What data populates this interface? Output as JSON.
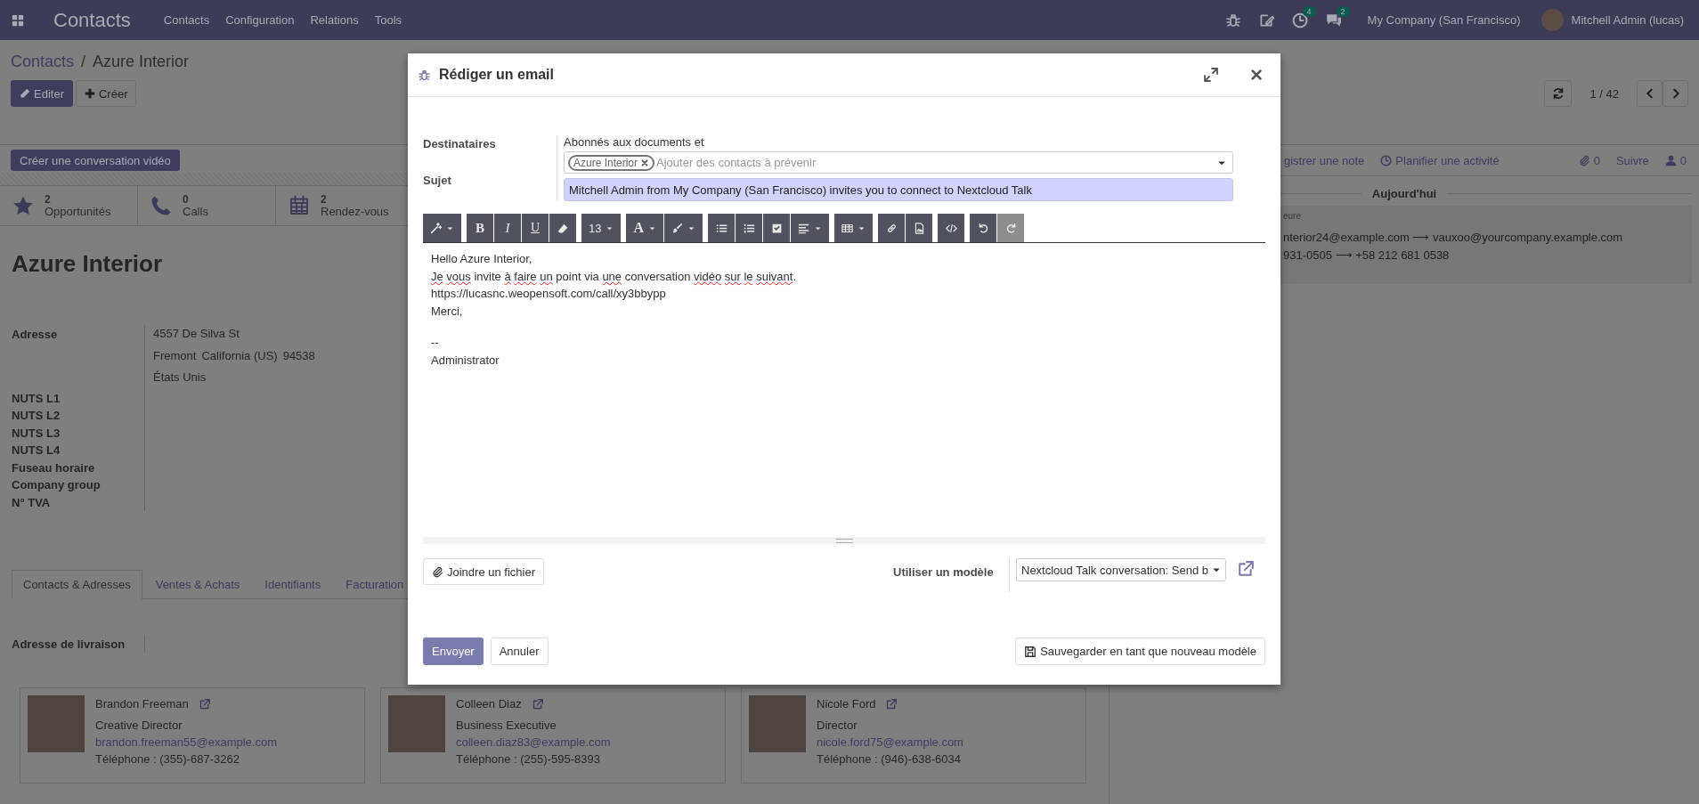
{
  "navbar": {
    "app_name": "Contacts",
    "menus": [
      "Contacts",
      "Configuration",
      "Relations",
      "Tools"
    ],
    "activity_count": "4",
    "message_count": "2",
    "company": "My Company (San Francisco)",
    "user": "Mitchell Admin (lucas)"
  },
  "breadcrumb": {
    "items": [
      "Contacts",
      "Azure Interior"
    ],
    "separator": "/"
  },
  "actions": [
    {
      "label": "Editer",
      "kind": "edit"
    },
    {
      "label": "Créer",
      "kind": "create"
    }
  ],
  "pager": "1 / 42",
  "status_button": "Créer une conversation vidéo",
  "stats": [
    {
      "count": "2",
      "label": "Opportunités",
      "kind": "opportunities"
    },
    {
      "count": "0",
      "label": "Calls",
      "kind": "calls"
    },
    {
      "count": "2",
      "label": "Rendez-vous",
      "kind": "meetings"
    }
  ],
  "partner": {
    "name": "Azure Interior",
    "address_label": "Adresse",
    "address_lines": [
      [
        "4557 De Silva St"
      ],
      [
        "Fremont",
        "California (US)",
        "94538"
      ],
      [
        "États Unis"
      ]
    ],
    "field_labels": [
      "NUTS L1",
      "NUTS L2",
      "NUTS L3",
      "NUTS L4",
      "Fuseau horaire",
      "Company group",
      "N° TVA"
    ]
  },
  "tabs": [
    {
      "label": "Contacts & Adresses",
      "selected": true
    },
    {
      "label": "Ventes & Achats",
      "selected": false
    },
    {
      "label": "Identifiants",
      "selected": false
    },
    {
      "label": "Facturation",
      "selected": false
    }
  ],
  "delivery_label": "Adresse de livraison",
  "contacts": [
    {
      "name": "Brandon Freeman",
      "function": "Creative Director",
      "email": "brandon.freeman55@example.com",
      "phone": "Téléphone : (355)-687-3262"
    },
    {
      "name": "Colleen Diaz",
      "function": "Business Executive",
      "email": "colleen.diaz83@example.com",
      "phone": "Téléphone : (255)-595-8393"
    },
    {
      "name": "Nicole Ford",
      "function": "Director",
      "email": "nicole.ford75@example.com",
      "phone": "Téléphone : (946)-638-6034"
    }
  ],
  "chatter": {
    "actions": [
      {
        "label": "gistrer une note",
        "kind": "note"
      },
      {
        "label": "Planifier une activité",
        "kind": "activity"
      }
    ],
    "attachments": "0",
    "follow": "Suivre",
    "followers": "0",
    "date_separator": "Aujourd'hui",
    "message": {
      "header": "eure",
      "lines": [
        "nterior24@example.com ⟶ vauxoo@yourcompany.example.com",
        "931-0505 ⟶ +58 212 681 0538"
      ]
    }
  },
  "modal": {
    "title": "Rédiger un email",
    "recipients_label": "Destinataires",
    "recipients_intro": "Abonnés aux documents et",
    "tags": [
      "Azure Interior"
    ],
    "recipients_placeholder": "Ajouter des contacts à prévenir",
    "subject_label": "Sujet",
    "subject": "Mitchell Admin from My Company (San Francisco) invites you to connect to Nextcloud Talk",
    "toolbar": [
      [
        {
          "kind": "style",
          "disabled": false
        }
      ],
      [
        {
          "kind": "bold",
          "label": "B",
          "disabled": false
        },
        {
          "kind": "italic",
          "label": "I",
          "disabled": false
        },
        {
          "kind": "underline",
          "label": "U",
          "disabled": false
        },
        {
          "kind": "eraser",
          "disabled": false
        }
      ],
      [
        {
          "kind": "size",
          "label": "13",
          "disabled": false
        }
      ],
      [
        {
          "kind": "color",
          "label": "A",
          "disabled": false
        },
        {
          "kind": "brush",
          "disabled": false
        }
      ],
      [
        {
          "kind": "list-ul",
          "disabled": false
        },
        {
          "kind": "list-ol",
          "disabled": false
        },
        {
          "kind": "checklist",
          "disabled": false
        },
        {
          "kind": "align",
          "disabled": false
        }
      ],
      [
        {
          "kind": "table",
          "disabled": false
        }
      ],
      [
        {
          "kind": "link",
          "disabled": false
        },
        {
          "kind": "image",
          "disabled": false
        }
      ],
      [
        {
          "kind": "code",
          "disabled": false
        }
      ],
      [
        {
          "kind": "undo",
          "disabled": false
        },
        {
          "kind": "redo",
          "disabled": true
        }
      ]
    ],
    "body": [
      {
        "words": [
          {
            "text": "Hello",
            "misspelled": false
          },
          {
            "text": "Azure",
            "misspelled": false
          },
          {
            "text": "Interior,",
            "misspelled": false
          }
        ]
      },
      {
        "words": [
          {
            "text": "Je",
            "misspelled": true
          },
          {
            "text": "vous",
            "misspelled": true
          },
          {
            "text": "invite",
            "misspelled": false
          },
          {
            "text": "à",
            "misspelled": true
          },
          {
            "text": "faire",
            "misspelled": true
          },
          {
            "text": "un",
            "misspelled": true
          },
          {
            "text": "point",
            "misspelled": false
          },
          {
            "text": "via",
            "misspelled": false
          },
          {
            "text": "une",
            "misspelled": true
          },
          {
            "text": "conversation",
            "misspelled": false
          },
          {
            "text": "vidéo",
            "misspelled": true
          },
          {
            "text": "sur",
            "misspelled": true
          },
          {
            "text": "le",
            "misspelled": true
          },
          {
            "text": "suivant",
            "misspelled": true
          },
          {
            "text": ".",
            "misspelled": false,
            "attached": true
          }
        ]
      },
      {
        "words": [
          {
            "text": "https://lucasnc.weopensoft.com/call/xy3bbypp",
            "misspelled": false
          }
        ]
      },
      {
        "words": [
          {
            "text": "Merci,",
            "misspelled": false
          }
        ]
      }
    ],
    "signature": [
      "--",
      "Administrator"
    ],
    "attach": "Joindre un fichier",
    "template_label": "Utiliser un modèle",
    "template": "Nextcloud Talk conversation: Send b",
    "buttons": [
      {
        "label": "Envoyer",
        "kind": "primary"
      },
      {
        "label": "Annuler",
        "kind": "secondary"
      }
    ],
    "save_template": "Sauvegarder en tant que nouveau modèle"
  }
}
